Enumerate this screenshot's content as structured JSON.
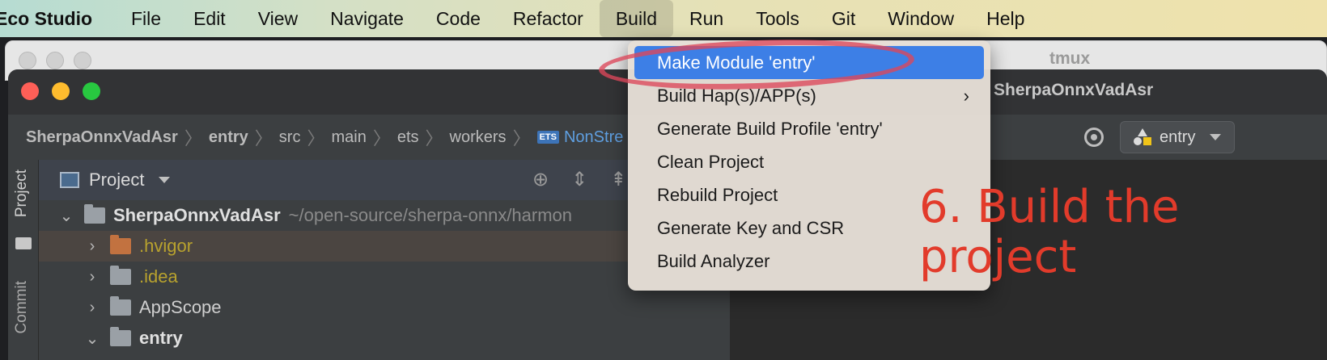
{
  "menubar": {
    "app_name": "Eco Studio",
    "items": [
      "File",
      "Edit",
      "View",
      "Navigate",
      "Code",
      "Refactor",
      "Build",
      "Run",
      "Tools",
      "Git",
      "Window",
      "Help"
    ],
    "active_item": "Build"
  },
  "tmux_window": {
    "title": "tmux"
  },
  "ide": {
    "title": "SherpaOnnxVadAsr",
    "breadcrumbs": [
      "SherpaOnnxVadAsr",
      "entry",
      "src",
      "main",
      "ets",
      "workers",
      "NonStre"
    ],
    "ets_icon_label": "ETS",
    "run_config": "entry",
    "left_strip": {
      "project_tab": "Project",
      "commit_tab": "Commit"
    },
    "project_panel": {
      "header": "Project",
      "tree": [
        {
          "label": "SherpaOnnxVadAsr",
          "path": "~/open-source/sherpa-onnx/harmon",
          "expanded": true
        },
        {
          "label": ".hvigor",
          "expanded": false,
          "selected": true
        },
        {
          "label": ".idea",
          "expanded": false
        },
        {
          "label": "AppScope",
          "expanded": false
        },
        {
          "label": "entry",
          "expanded": true
        }
      ]
    }
  },
  "build_menu": {
    "items": [
      {
        "label": "Make Module 'entry'",
        "highlighted": true
      },
      {
        "label": "Build Hap(s)/APP(s)",
        "submenu": true
      },
      {
        "label": "Generate Build Profile 'entry'"
      },
      {
        "label": "Clean Project"
      },
      {
        "label": "Rebuild Project"
      },
      {
        "label": "Generate Key and CSR"
      },
      {
        "label": "Build Analyzer"
      }
    ],
    "submenu_arrow": "›"
  },
  "annotation": {
    "line1": "6. Build the",
    "line2": "project",
    "color": "#e23b2b"
  },
  "colors": {
    "highlight": "#3d7fe6",
    "ellipse": "#dc465a"
  }
}
